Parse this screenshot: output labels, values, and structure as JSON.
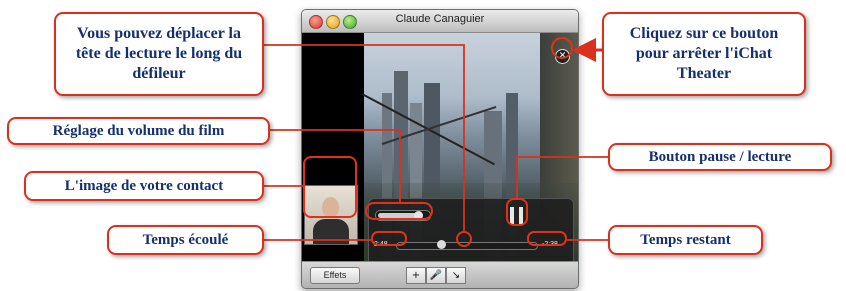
{
  "window": {
    "title": "Claude Canaguier",
    "effects_button_label": "Effets",
    "toolbar_buttons": [
      "+",
      "🎤",
      "↘"
    ]
  },
  "player": {
    "elapsed_time": "2:48",
    "remaining_time": "-2:38",
    "volume_level": 0.85,
    "playhead_position": 0.32
  },
  "callouts": {
    "playhead": "Vous pouvez déplacer la tête de lecture le long du défileur",
    "stop_theater": "Cliquez sur ce bouton pour arrêter l'iChat Theater",
    "volume": "Réglage du volume du film",
    "pause_play": "Bouton pause / lecture",
    "contact_image": "L'image de votre contact",
    "elapsed": "Temps écoulé",
    "remaining": "Temps restant"
  },
  "colors": {
    "callout_border": "#d8321d",
    "callout_text": "#16306e",
    "highlight_ring": "#e0321b"
  }
}
